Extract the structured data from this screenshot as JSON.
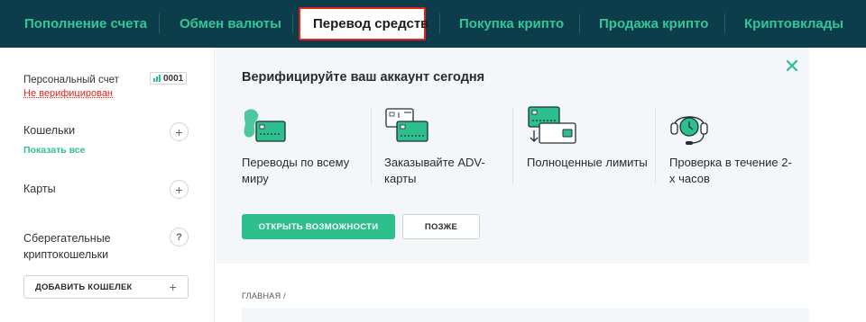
{
  "nav": {
    "items": [
      {
        "label": "Пополнение счета",
        "active": false
      },
      {
        "label": "Обмен валюты",
        "active": false
      },
      {
        "label": "Перевод средств",
        "active": true
      },
      {
        "label": "Покупка крипто",
        "active": false
      },
      {
        "label": "Продажа крипто",
        "active": false
      },
      {
        "label": "Криптовклады",
        "active": false
      }
    ]
  },
  "sidebar": {
    "account_label": "Персональный счет",
    "account_number": "0001",
    "account_status": "Не верифицирован",
    "wallets_title": "Кошельки",
    "wallets_link": "Показать все",
    "cards_title": "Карты",
    "savings_title": "Сберегательные криптокошельки",
    "savings_help": "?",
    "add_wallet_label": "ДОБАВИТЬ КОШЕЛЕК",
    "add_icon": "plus-icon"
  },
  "banner": {
    "title": "Верифицируйте ваш аккаунт сегодня",
    "features": [
      {
        "text": "Переводы по всему миру",
        "icon": "globe-card-icon"
      },
      {
        "text": "Заказывайте ADV-карты",
        "icon": "adv-card-icon"
      },
      {
        "text": "Полноценные лимиты",
        "icon": "wallet-limits-icon"
      },
      {
        "text": "Проверка в течение 2-х часов",
        "icon": "support-headset-icon"
      }
    ],
    "primary_button": "ОТКРЫТЬ ВОЗМОЖНОСТИ",
    "secondary_button": "ПОЗЖЕ"
  },
  "breadcrumb": "ГЛАВНАЯ /",
  "colors": {
    "nav_bg": "#0d3d4a",
    "accent": "#2fbf8c",
    "highlight": "#e2231a",
    "banner_bg": "#f3f7f9"
  }
}
